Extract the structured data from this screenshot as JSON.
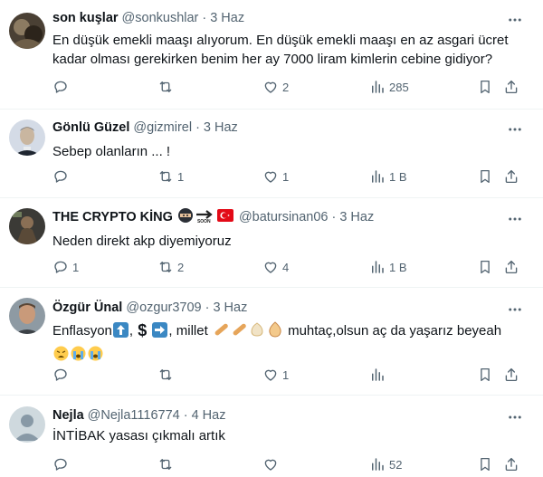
{
  "replies": [
    {
      "name": "son kuşlar",
      "handle": "@sonkushlar",
      "date": "3 Haz",
      "text": "En düşük emekli maaşı alıyorum. En düşük emekli maaşı en az asgari ücret kadar olması gerekirken benim her ay 7000 liram kimlerin cebine gidiyor?",
      "counts": {
        "reply": "",
        "retweet": "",
        "like": "2",
        "views": "285"
      }
    },
    {
      "name": "Gönlü Güzel",
      "handle": "@gizmirel",
      "date": "3 Haz",
      "text": "Sebep olanların ... !",
      "counts": {
        "reply": "",
        "retweet": "1",
        "like": "1",
        "views": "1 B"
      }
    },
    {
      "name": "THE CRYPTO KİNG",
      "handle": "@batursinan06",
      "date": "3 Haz",
      "text": "Neden direkt akp diyemiyoruz",
      "badge_text": "SOON",
      "counts": {
        "reply": "1",
        "retweet": "2",
        "like": "4",
        "views": "1 B"
      }
    },
    {
      "name": "Özgür Ünal",
      "handle": "@ozgur3709",
      "date": "3 Haz",
      "text_parts": [
        "Enflasyon",
        ", ",
        " ",
        ", millet ",
        " muhtaç,olsun aç da yaşarız beyeah"
      ],
      "counts": {
        "reply": "",
        "retweet": "",
        "like": "1",
        "views": ""
      }
    },
    {
      "name": "Nejla",
      "handle": "@Nejla1116774",
      "date": "4 Haz",
      "text": "İNTİBAK yasası çıkmalı artık",
      "counts": {
        "reply": "",
        "retweet": "",
        "like": "",
        "views": "52"
      }
    }
  ],
  "colors": {
    "text": "#0f1419",
    "secondary": "#536471",
    "divider": "#eff3f4"
  },
  "icons": [
    "more-icon",
    "reply-icon",
    "retweet-icon",
    "like-icon",
    "views-icon",
    "bookmark-icon",
    "share-icon"
  ]
}
